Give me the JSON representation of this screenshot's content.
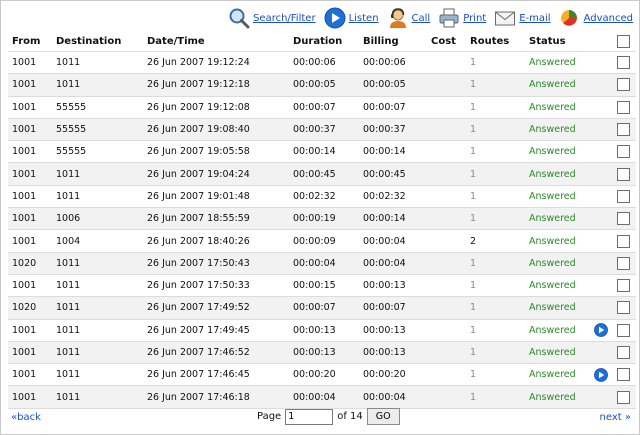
{
  "toolbar": {
    "items": [
      {
        "label": "Search/Filter",
        "icon": "magnifier-icon"
      },
      {
        "label": "Listen",
        "icon": "play-icon"
      },
      {
        "label": "Call",
        "icon": "operator-icon"
      },
      {
        "label": "Print",
        "icon": "printer-icon"
      },
      {
        "label": "E-mail",
        "icon": "envelope-icon"
      },
      {
        "label": "Advanced",
        "icon": "chart-icon"
      }
    ]
  },
  "table": {
    "columns": [
      "From",
      "Destination",
      "Date/Time",
      "Duration",
      "Billing",
      "Cost",
      "Routes",
      "Status"
    ],
    "rows": [
      {
        "from": "1001",
        "dest": "1011",
        "datetime": "26 Jun 2007 19:12:24",
        "duration": "00:00:06",
        "billing": "00:00:06",
        "cost": "",
        "routes": "1",
        "status": "Answered",
        "listen": false
      },
      {
        "from": "1001",
        "dest": "1011",
        "datetime": "26 Jun 2007 19:12:18",
        "duration": "00:00:05",
        "billing": "00:00:05",
        "cost": "",
        "routes": "1",
        "status": "Answered",
        "listen": false
      },
      {
        "from": "1001",
        "dest": "55555",
        "datetime": "26 Jun 2007 19:12:08",
        "duration": "00:00:07",
        "billing": "00:00:07",
        "cost": "",
        "routes": "1",
        "status": "Answered",
        "listen": false
      },
      {
        "from": "1001",
        "dest": "55555",
        "datetime": "26 Jun 2007 19:08:40",
        "duration": "00:00:37",
        "billing": "00:00:37",
        "cost": "",
        "routes": "1",
        "status": "Answered",
        "listen": false
      },
      {
        "from": "1001",
        "dest": "55555",
        "datetime": "26 Jun 2007 19:05:58",
        "duration": "00:00:14",
        "billing": "00:00:14",
        "cost": "",
        "routes": "1",
        "status": "Answered",
        "listen": false
      },
      {
        "from": "1001",
        "dest": "1011",
        "datetime": "26 Jun 2007 19:04:24",
        "duration": "00:00:45",
        "billing": "00:00:45",
        "cost": "",
        "routes": "1",
        "status": "Answered",
        "listen": false
      },
      {
        "from": "1001",
        "dest": "1011",
        "datetime": "26 Jun 2007 19:01:48",
        "duration": "00:02:32",
        "billing": "00:02:32",
        "cost": "",
        "routes": "1",
        "status": "Answered",
        "listen": false
      },
      {
        "from": "1001",
        "dest": "1006",
        "datetime": "26 Jun 2007 18:55:59",
        "duration": "00:00:19",
        "billing": "00:00:14",
        "cost": "",
        "routes": "1",
        "status": "Answered",
        "listen": false
      },
      {
        "from": "1001",
        "dest": "1004",
        "datetime": "26 Jun 2007 18:40:26",
        "duration": "00:00:09",
        "billing": "00:00:04",
        "cost": "",
        "routes": "2",
        "status": "Answered",
        "listen": false
      },
      {
        "from": "1020",
        "dest": "1011",
        "datetime": "26 Jun 2007 17:50:43",
        "duration": "00:00:04",
        "billing": "00:00:04",
        "cost": "",
        "routes": "1",
        "status": "Answered",
        "listen": false
      },
      {
        "from": "1001",
        "dest": "1011",
        "datetime": "26 Jun 2007 17:50:33",
        "duration": "00:00:15",
        "billing": "00:00:13",
        "cost": "",
        "routes": "1",
        "status": "Answered",
        "listen": false
      },
      {
        "from": "1020",
        "dest": "1011",
        "datetime": "26 Jun 2007 17:49:52",
        "duration": "00:00:07",
        "billing": "00:00:07",
        "cost": "",
        "routes": "1",
        "status": "Answered",
        "listen": false
      },
      {
        "from": "1001",
        "dest": "1011",
        "datetime": "26 Jun 2007 17:49:45",
        "duration": "00:00:13",
        "billing": "00:00:13",
        "cost": "",
        "routes": "1",
        "status": "Answered",
        "listen": true
      },
      {
        "from": "1001",
        "dest": "1011",
        "datetime": "26 Jun 2007 17:46:52",
        "duration": "00:00:13",
        "billing": "00:00:13",
        "cost": "",
        "routes": "1",
        "status": "Answered",
        "listen": false
      },
      {
        "from": "1001",
        "dest": "1011",
        "datetime": "26 Jun 2007 17:46:45",
        "duration": "00:00:20",
        "billing": "00:00:20",
        "cost": "",
        "routes": "1",
        "status": "Answered",
        "listen": true
      },
      {
        "from": "1001",
        "dest": "1011",
        "datetime": "26 Jun 2007 17:46:18",
        "duration": "00:00:04",
        "billing": "00:00:04",
        "cost": "",
        "routes": "1",
        "status": "Answered",
        "listen": false
      }
    ]
  },
  "footer": {
    "back_label": "«back",
    "next_label": "next »",
    "page_label": "Page",
    "page_value": "1",
    "of_label": "of 14",
    "go_label": "GO"
  },
  "colors": {
    "link": "#1a4fc7",
    "status_answered": "#2a8a2a",
    "row_alt": "#f2f2f2",
    "listen_blue": "#1f6fd8"
  }
}
